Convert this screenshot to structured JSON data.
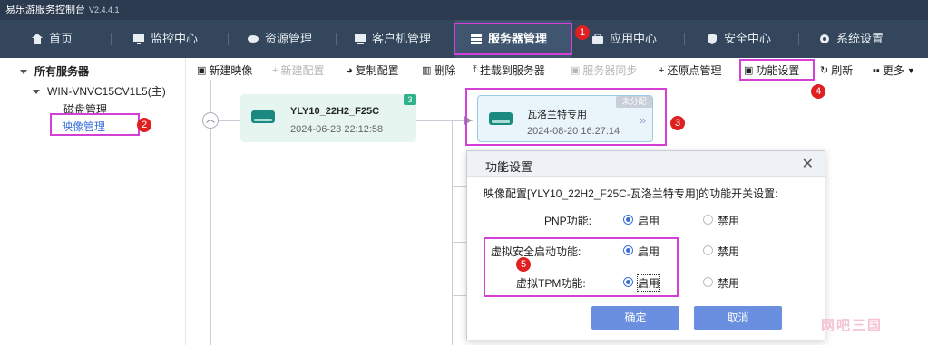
{
  "app": {
    "title": "易乐游服务控制台",
    "version": "V2.4.4.1"
  },
  "nav": [
    {
      "label": "首页",
      "icon": "home-icon"
    },
    {
      "label": "监控中心",
      "icon": "monitor-icon"
    },
    {
      "label": "资源管理",
      "icon": "resource-icon"
    },
    {
      "label": "客户机管理",
      "icon": "client-icon"
    },
    {
      "label": "服务器管理",
      "icon": "server-icon",
      "active": true
    },
    {
      "label": "应用中心",
      "icon": "app-icon"
    },
    {
      "label": "安全中心",
      "icon": "shield-icon"
    },
    {
      "label": "系统设置",
      "icon": "gear-icon"
    }
  ],
  "sidebar": {
    "root": "所有服务器",
    "server": "WIN-VNVC15CV1L5(主)",
    "items": [
      {
        "label": "磁盘管理"
      },
      {
        "label": "映像管理"
      }
    ]
  },
  "toolbar": [
    {
      "label": "新建映像",
      "glyph": "▣"
    },
    {
      "label": "新建配置",
      "glyph": "+",
      "disabled": true
    },
    {
      "label": "复制配置",
      "glyph": "◕"
    },
    {
      "label": "删除",
      "glyph": "▥"
    },
    {
      "label": "挂载到服务器",
      "glyph": "⤒"
    },
    {
      "label": "服务器同步",
      "glyph": "▣",
      "disabled": true
    },
    {
      "label": "还原点管理",
      "glyph": "+"
    },
    {
      "label": "功能设置",
      "glyph": "▣"
    },
    {
      "label": "刷新",
      "glyph": "↻"
    },
    {
      "label": "更多",
      "glyph": "▪▪"
    }
  ],
  "cards": [
    {
      "name": "YLY10_22H2_F25C",
      "time": "2024-06-23 22:12:58",
      "badge": "3"
    },
    {
      "name": "瓦洛兰特专用",
      "time": "2024-08-20 16:27:14",
      "badge": "未分配",
      "chevron": "»"
    }
  ],
  "dialog": {
    "title": "功能设置",
    "close": "✕",
    "desc": "映像配置[YLY10_22H2_F25C-瓦洛兰特专用]的功能开关设置:",
    "rows": [
      {
        "label": "PNP功能:",
        "on": "启用",
        "off": "禁用",
        "value": "on"
      },
      {
        "label": "虚拟安全启动功能:",
        "on": "启用",
        "off": "禁用",
        "value": "on"
      },
      {
        "label": "虚拟TPM功能:",
        "on": "启用",
        "off": "禁用",
        "value": "on"
      }
    ],
    "ok": "确定",
    "cancel": "取消"
  },
  "markers": [
    "1",
    "2",
    "3",
    "4",
    "5"
  ],
  "watermark": "网吧三国",
  "colors": {
    "highlight": "#d43fd6",
    "marker": "#e02020",
    "nav_bg": "#34465c",
    "accent": "#6b8fe0",
    "card_green": "#2fb28a"
  }
}
